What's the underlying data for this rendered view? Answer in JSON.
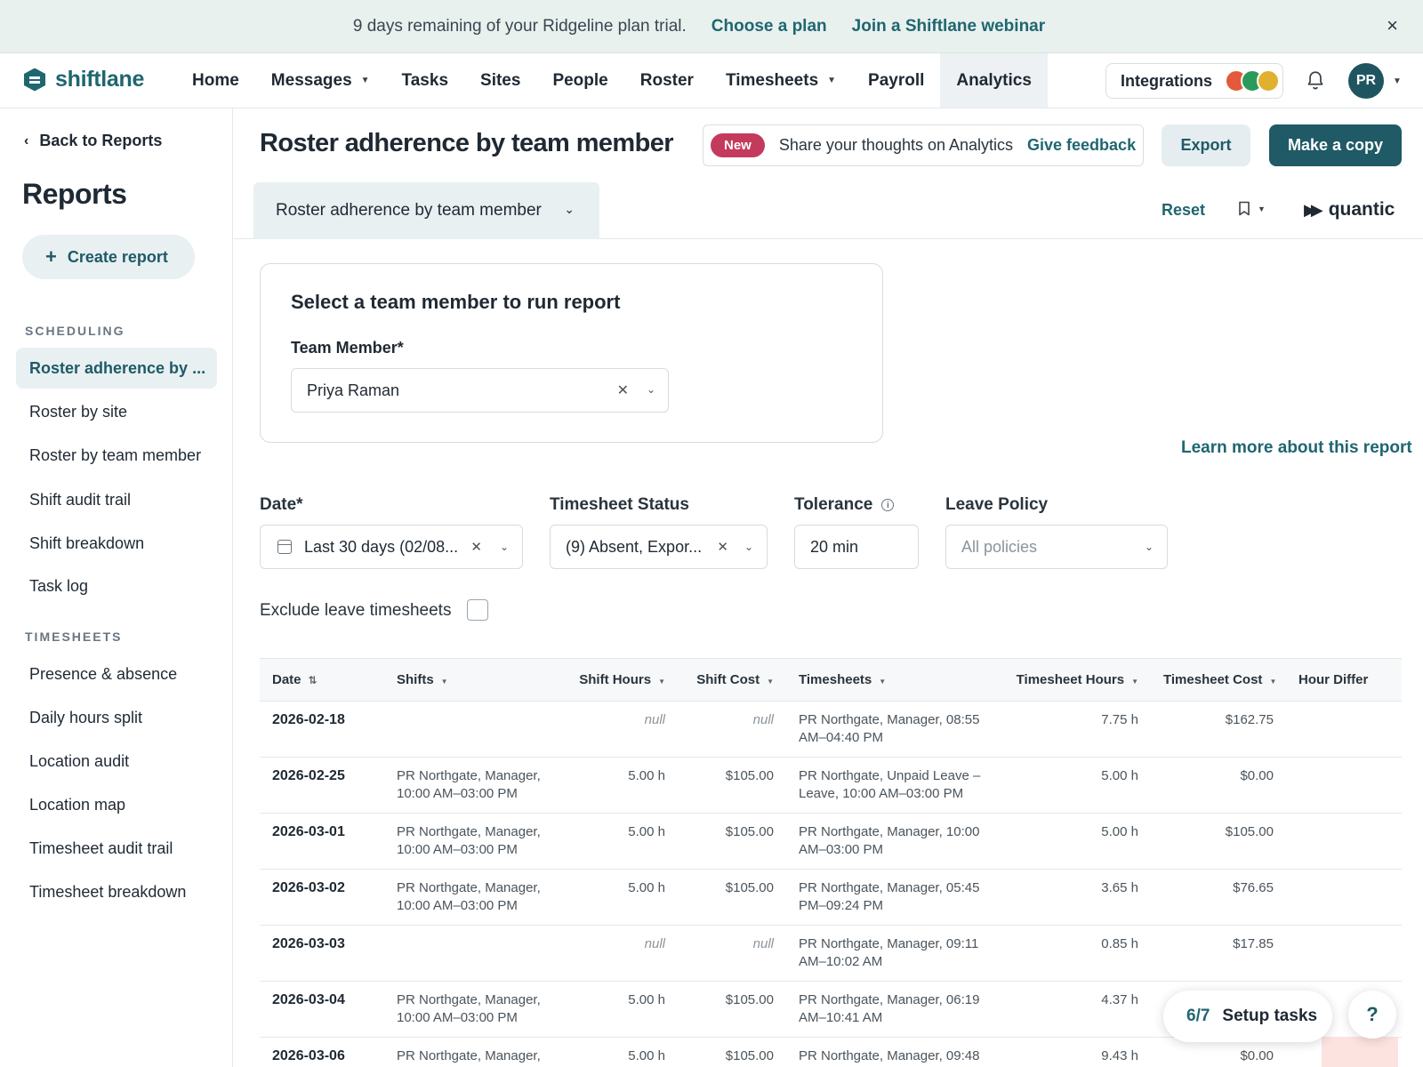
{
  "banner": {
    "message": "9 days remaining of your Ridgeline plan trial.",
    "choose_plan": "Choose a plan",
    "webinar": "Join a Shiftlane webinar",
    "close": "×"
  },
  "brand": {
    "name": "shiftlane"
  },
  "nav": {
    "items": [
      {
        "label": "Home"
      },
      {
        "label": "Messages",
        "has_caret": true
      },
      {
        "label": "Tasks"
      },
      {
        "label": "Sites"
      },
      {
        "label": "People"
      },
      {
        "label": "Roster"
      },
      {
        "label": "Timesheets",
        "has_caret": true
      },
      {
        "label": "Payroll"
      },
      {
        "label": "Analytics",
        "active": true
      }
    ],
    "integrations": "Integrations",
    "avatar_initials": "PR"
  },
  "sidebar": {
    "back": "Back to Reports",
    "title": "Reports",
    "create": "Create report",
    "sections": [
      {
        "title": "SCHEDULING",
        "items": [
          "Roster adherence by ...",
          "Roster by site",
          "Roster by team member",
          "Shift audit trail",
          "Shift breakdown",
          "Task log"
        ]
      },
      {
        "title": "TIMESHEETS",
        "items": [
          "Presence & absence",
          "Daily hours split",
          "Location audit",
          "Location map",
          "Timesheet audit trail",
          "Timesheet breakdown"
        ]
      }
    ]
  },
  "header": {
    "title": "Roster adherence by team member",
    "badge": "New",
    "feedback_text": "Share your thoughts on Analytics",
    "feedback_link": "Give feedback",
    "export": "Export",
    "copy": "Make a copy"
  },
  "toolbar": {
    "report_select": "Roster adherence by team member",
    "reset": "Reset",
    "quantic": "quantic"
  },
  "panel": {
    "title": "Select a team member to run report",
    "label": "Team Member*",
    "value": "Priya Raman"
  },
  "learn_more": "Learn more about this report",
  "filters": {
    "date_label": "Date*",
    "date_value": "Last 30 days (02/08...",
    "status_label": "Timesheet Status",
    "status_value": "(9) Absent, Expor...",
    "tolerance_label": "Tolerance",
    "tolerance_value": "20 min",
    "leave_label": "Leave Policy",
    "leave_placeholder": "All policies",
    "exclude_label": "Exclude leave timesheets"
  },
  "table": {
    "columns": [
      "Date",
      "Shifts",
      "Shift Hours",
      "Shift Cost",
      "Timesheets",
      "Timesheet Hours",
      "Timesheet Cost",
      "Hour Differ"
    ],
    "rows": [
      [
        "2026-02-18",
        "",
        "null",
        "null",
        "PR Northgate, Manager, 08:55 AM–04:40 PM",
        "7.75 h",
        "$162.75",
        ""
      ],
      [
        "2026-02-25",
        "PR Northgate, Manager, 10:00 AM–03:00 PM",
        "5.00 h",
        "$105.00",
        "PR Northgate, Unpaid Leave – Leave, 10:00 AM–03:00 PM",
        "5.00 h",
        "$0.00",
        ""
      ],
      [
        "2026-03-01",
        "PR Northgate, Manager, 10:00 AM–03:00 PM",
        "5.00 h",
        "$105.00",
        "PR Northgate, Manager, 10:00 AM–03:00 PM",
        "5.00 h",
        "$105.00",
        ""
      ],
      [
        "2026-03-02",
        "PR Northgate, Manager, 10:00 AM–03:00 PM",
        "5.00 h",
        "$105.00",
        "PR Northgate, Manager, 05:45 PM–09:24 PM",
        "3.65 h",
        "$76.65",
        ""
      ],
      [
        "2026-03-03",
        "",
        "null",
        "null",
        "PR Northgate, Manager, 09:11 AM–10:02 AM",
        "0.85 h",
        "$17.85",
        ""
      ],
      [
        "2026-03-04",
        "PR Northgate, Manager, 10:00 AM–03:00 PM",
        "5.00 h",
        "$105.00",
        "PR Northgate, Manager, 06:19 AM–10:41 AM",
        "4.37 h",
        "",
        ""
      ],
      [
        "2026-03-06",
        "PR Northgate, Manager,",
        "5.00 h",
        "$105.00",
        "PR Northgate, Manager, 09:48",
        "9.43 h",
        "$0.00",
        ""
      ]
    ]
  },
  "floating": {
    "setup_count": "6/7",
    "setup_label": "Setup tasks",
    "help": "?"
  }
}
